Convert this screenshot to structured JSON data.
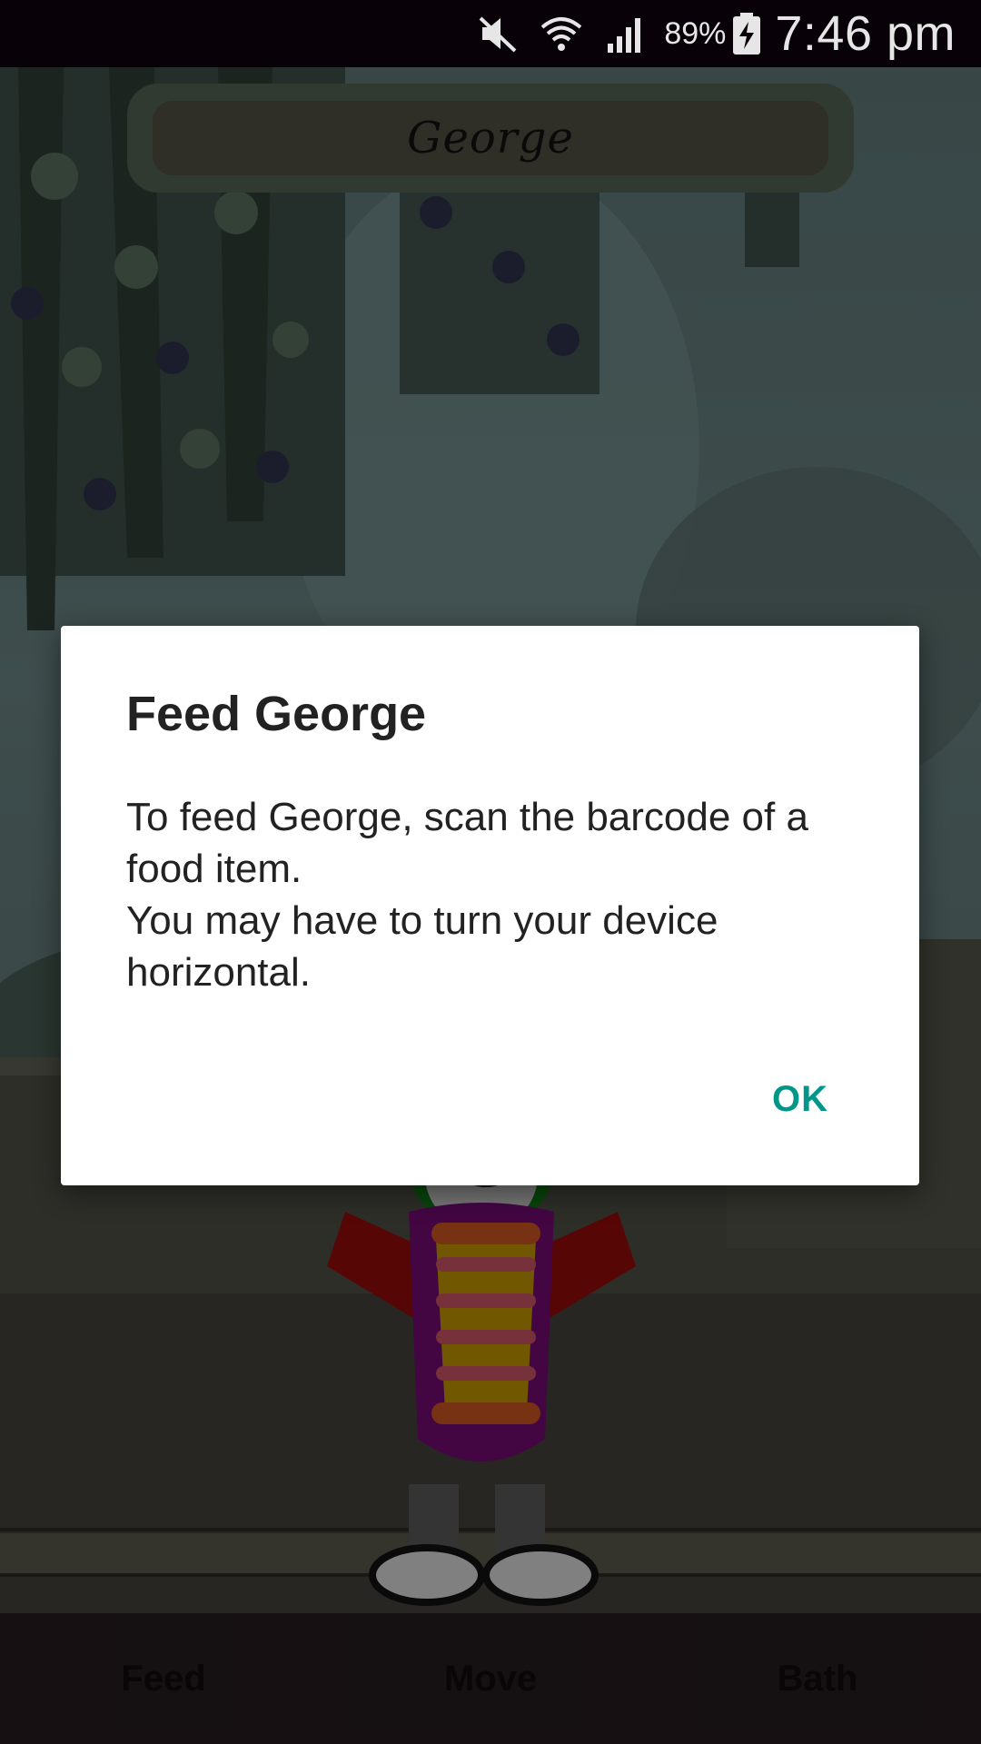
{
  "status_bar": {
    "battery_percent": "89%",
    "time": "7:46 pm",
    "icons": [
      "mute-icon",
      "wifi-icon",
      "signal-icon",
      "battery-charging-icon"
    ]
  },
  "game": {
    "pet_name": "George",
    "character": "teddy-bear-in-striped-sweater"
  },
  "bottom_nav": {
    "items": [
      {
        "label": "Feed"
      },
      {
        "label": "Move"
      },
      {
        "label": "Bath"
      }
    ]
  },
  "dialog": {
    "title": "Feed George",
    "message": "To feed George, scan the barcode of a food item.\nYou may have to turn your device horizontal.",
    "ok_label": "OK",
    "ok_color": "#009688"
  }
}
